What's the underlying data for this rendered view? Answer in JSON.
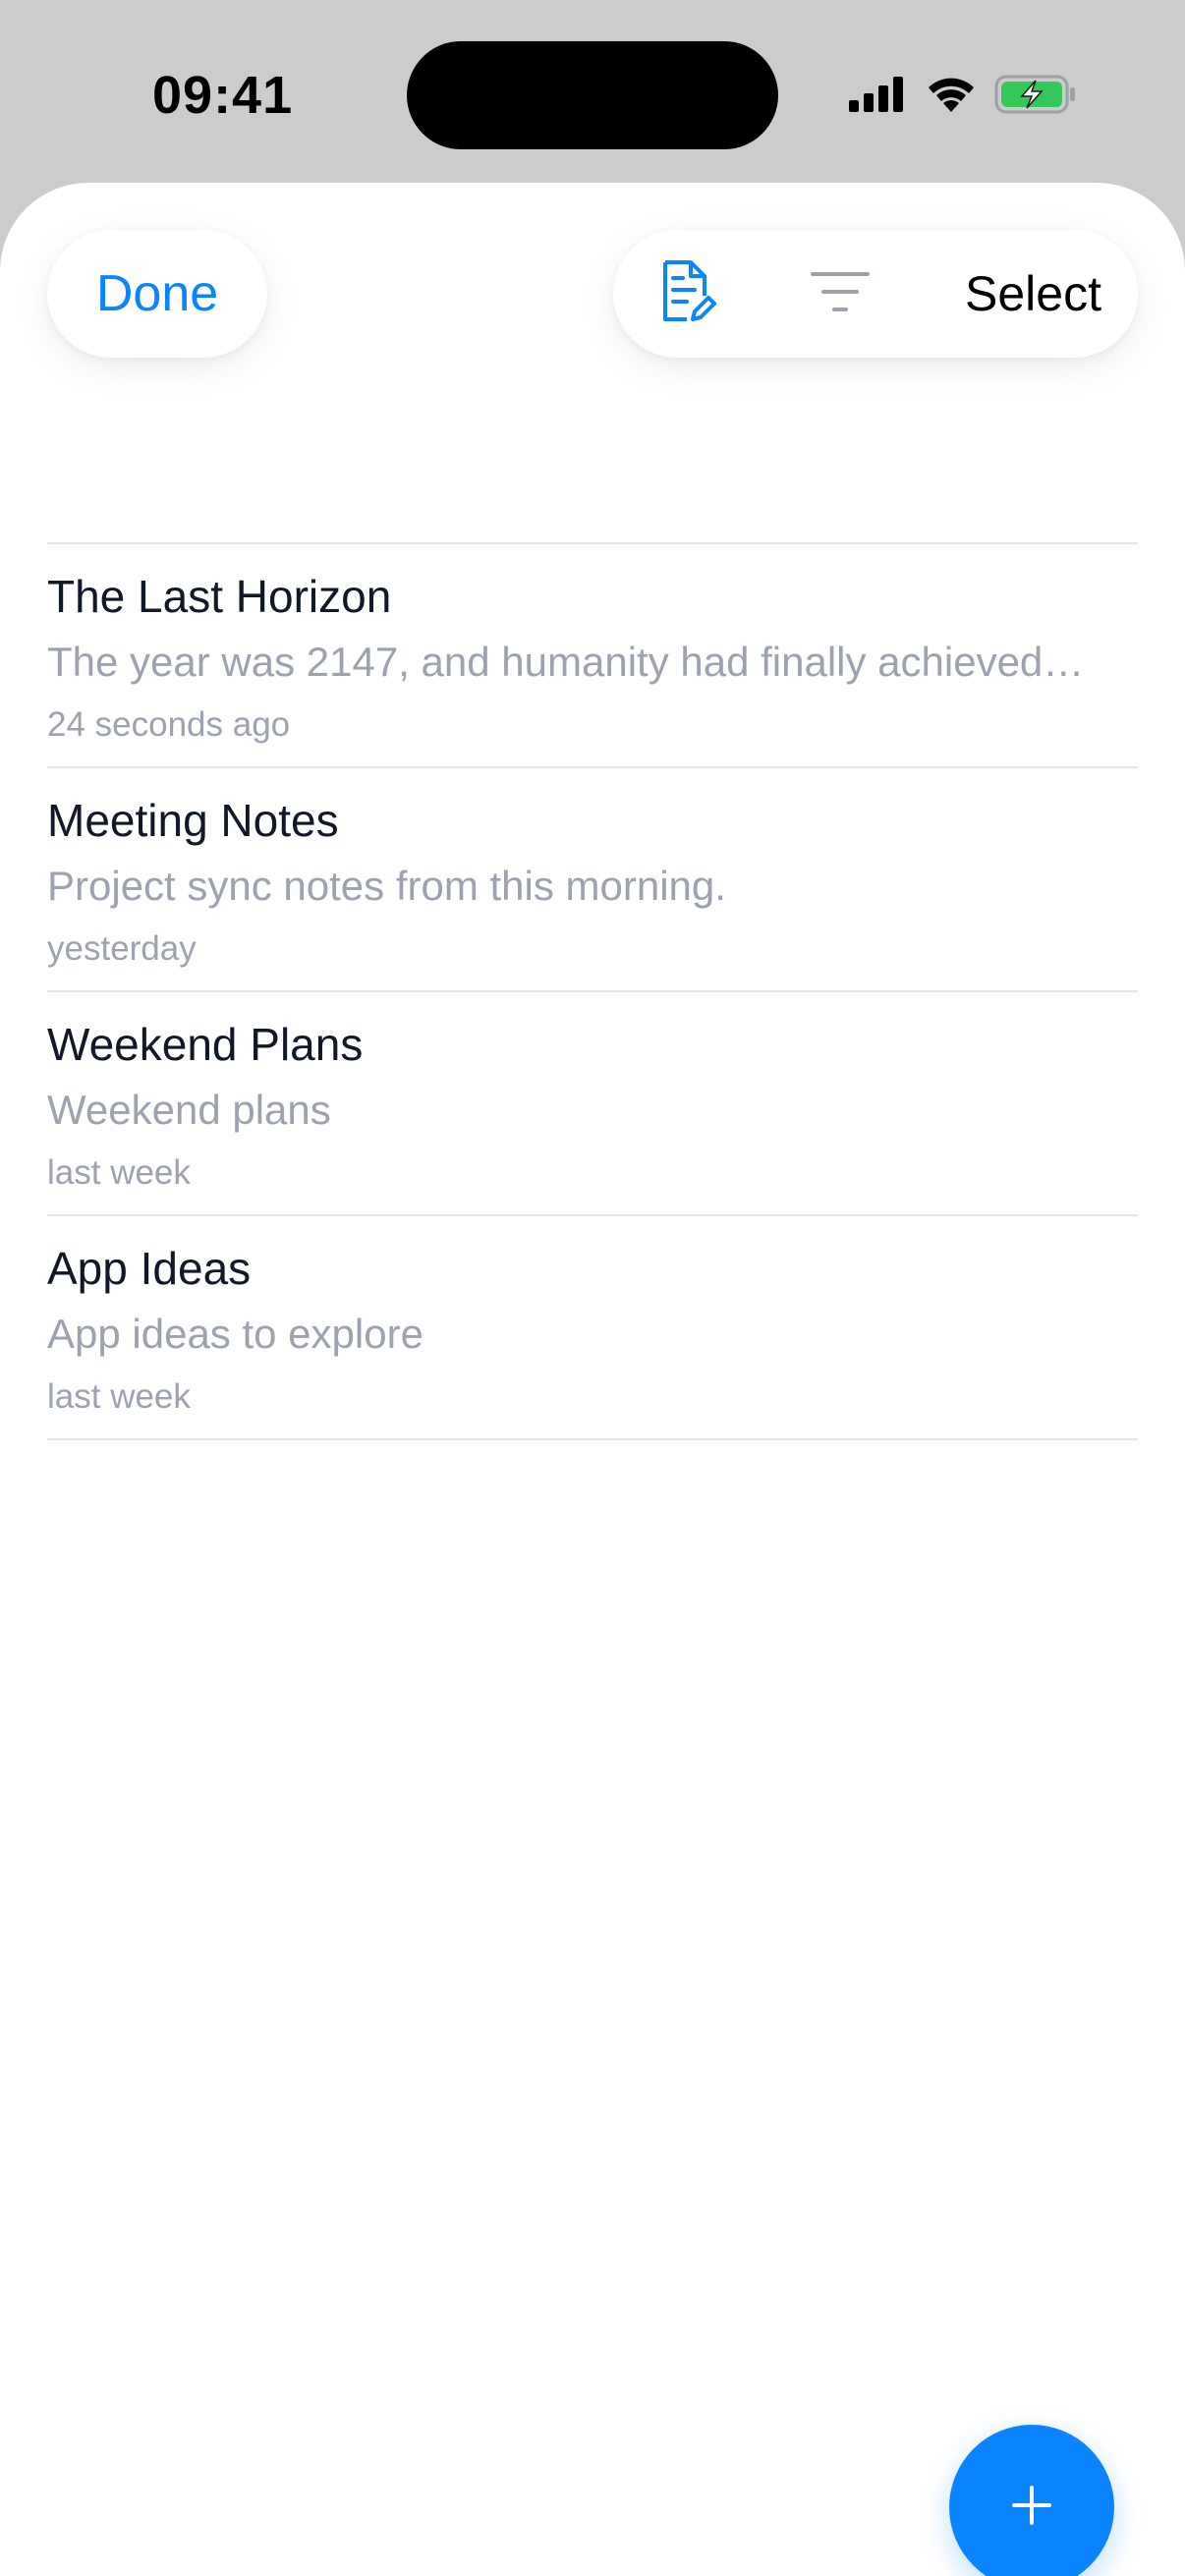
{
  "status_bar": {
    "time": "09:41"
  },
  "toolbar": {
    "done_label": "Done",
    "select_label": "Select",
    "compose_icon": "note-edit-icon",
    "filter_icon": "filter-icon"
  },
  "notes": [
    {
      "title": "The Last Horizon",
      "snippet": "The year was 2147, and humanity had finally achieved…",
      "time": "24 seconds ago"
    },
    {
      "title": "Meeting Notes",
      "snippet": "Project sync notes from this morning.",
      "time": "yesterday"
    },
    {
      "title": "Weekend Plans",
      "snippet": "Weekend plans",
      "time": "last week"
    },
    {
      "title": "App Ideas",
      "snippet": "App ideas to explore",
      "time": "last week"
    }
  ],
  "fab": {
    "icon": "plus-icon"
  },
  "colors": {
    "accent": "#0a84ff",
    "title": "#111827",
    "secondary": "#9ca3af",
    "divider": "#e3e6ea",
    "battery": "#34c759"
  }
}
